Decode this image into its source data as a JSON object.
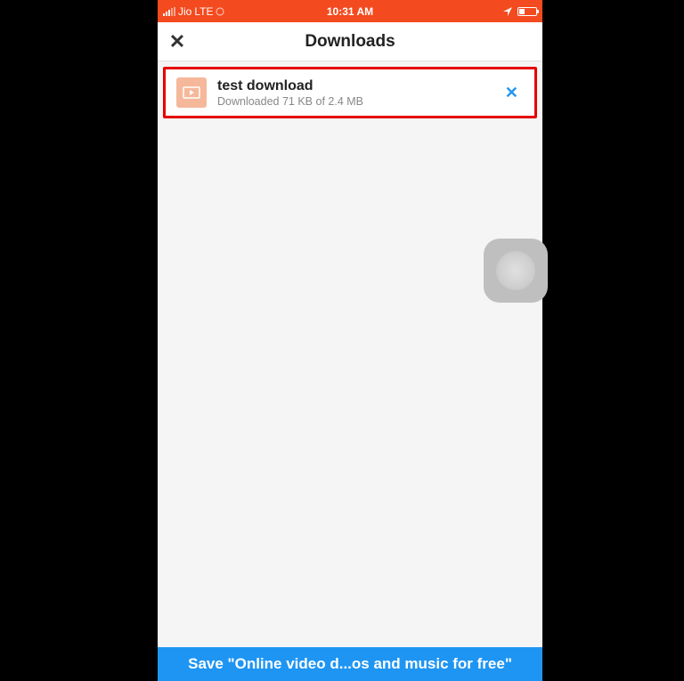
{
  "status_bar": {
    "carrier": "Jio",
    "network": "LTE",
    "time": "10:31 AM"
  },
  "header": {
    "title": "Downloads",
    "close_label": "✕"
  },
  "downloads": [
    {
      "title": "test download",
      "status": "Downloaded 71 KB of 2.4 MB",
      "cancel_label": "✕"
    }
  ],
  "bottom_banner": {
    "text": "Save \"Online video d...os and music for free\""
  }
}
